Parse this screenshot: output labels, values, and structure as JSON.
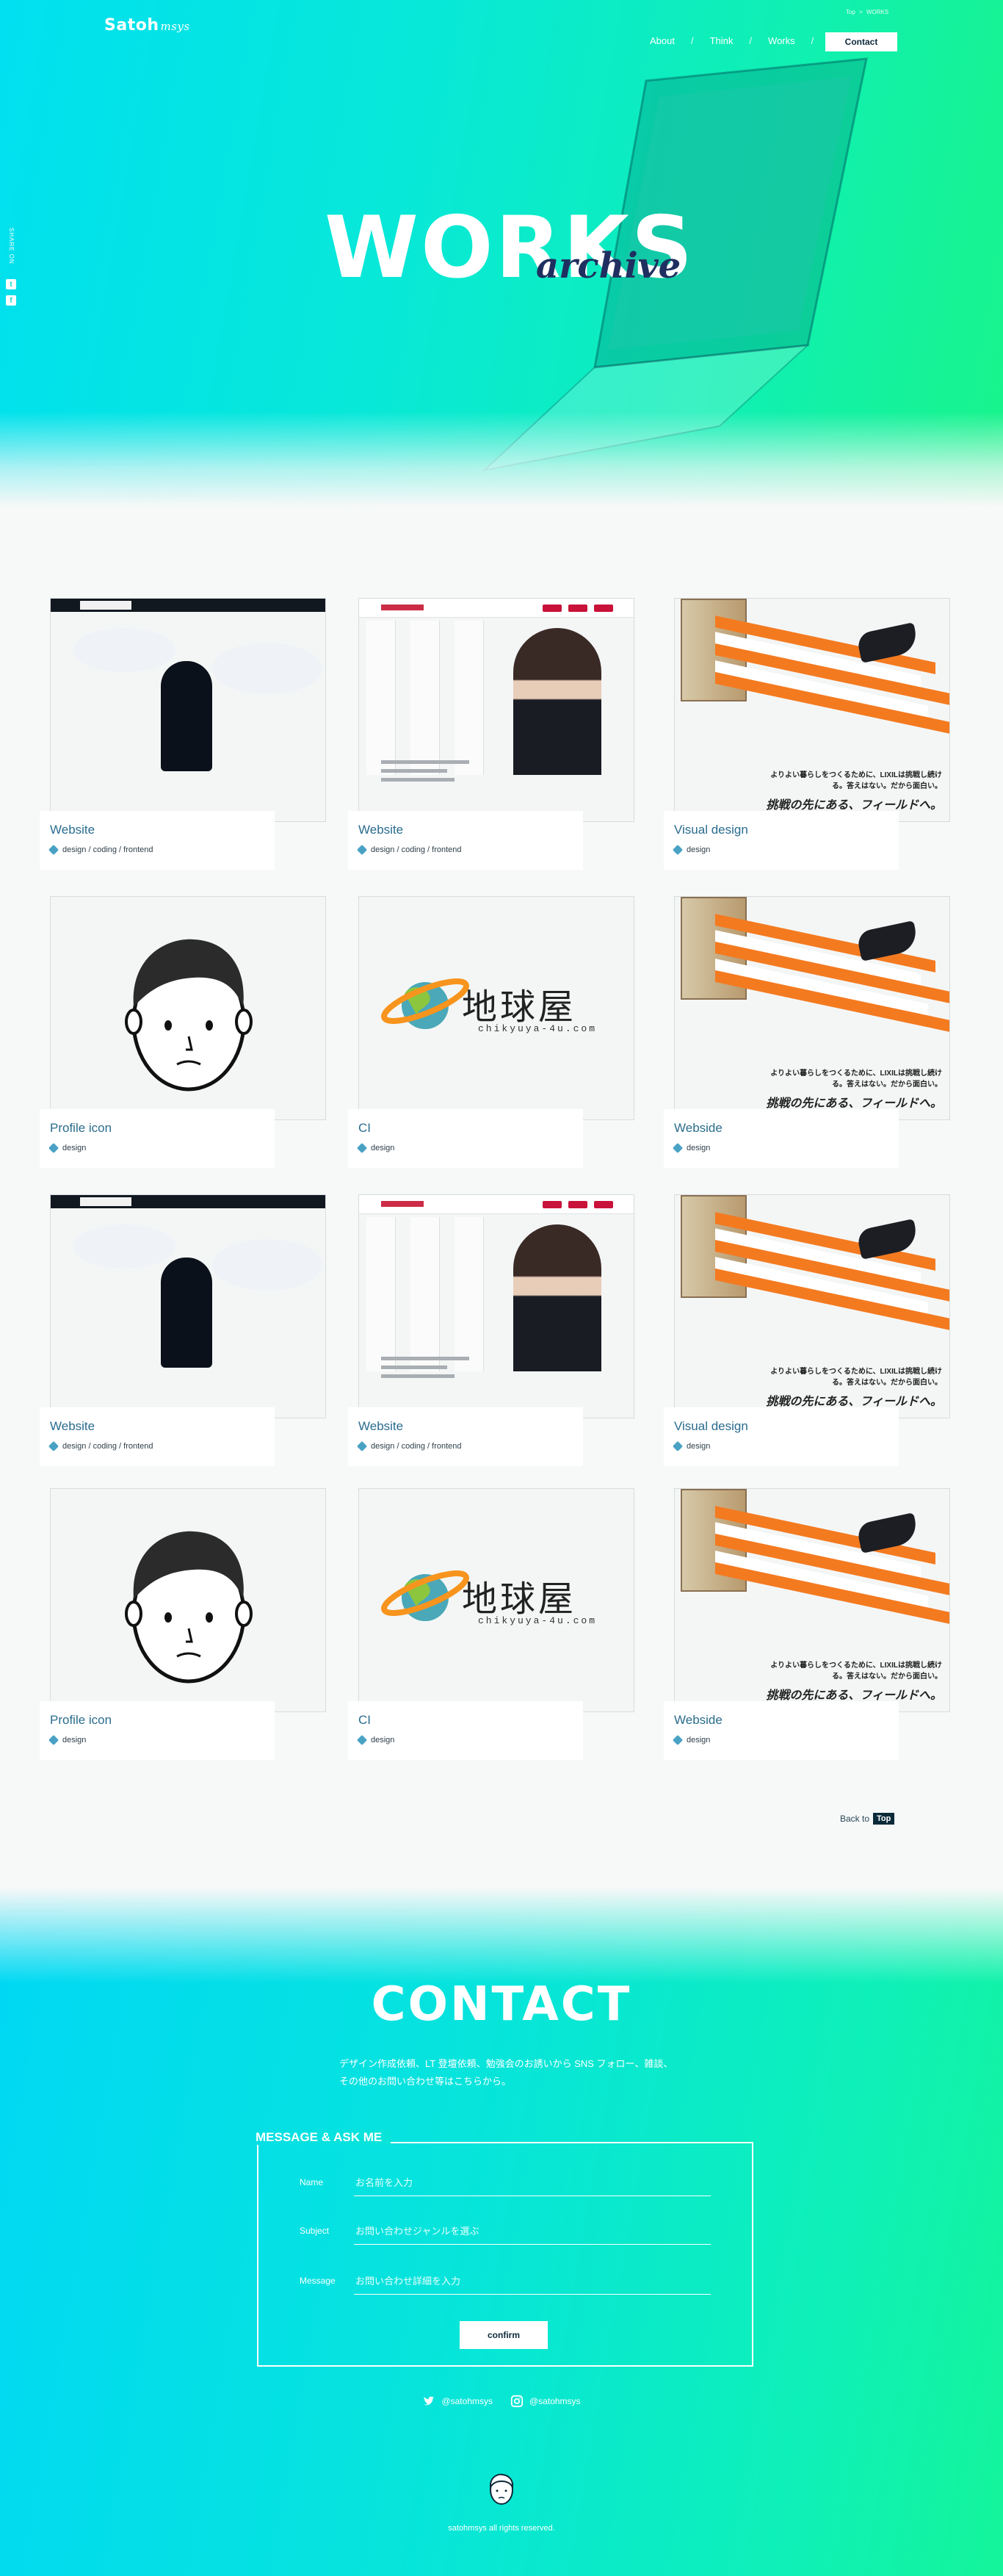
{
  "header": {
    "logo_main": "Satoh",
    "logo_script": "msys",
    "breadcrumb": [
      "Top",
      ">",
      "WORKS"
    ],
    "nav": [
      {
        "label": "About"
      },
      {
        "label": "Think"
      },
      {
        "label": "Works"
      }
    ],
    "nav_separator": "/",
    "contact_button": "Contact",
    "share_label": "SHARE ON",
    "share_twitter_icon": "t",
    "share_facebook_icon": "f"
  },
  "hero": {
    "title": "WORKS",
    "subtitle": "archive"
  },
  "works": [
    {
      "title": "Website",
      "tags": "design / coding / frontend",
      "thumb": "website-panasonic"
    },
    {
      "title": "Website",
      "tags": "design / coding / frontend",
      "thumb": "website-recruit"
    },
    {
      "title": "Visual design",
      "tags": "design",
      "thumb": "visual-lixil"
    },
    {
      "title": "Profile icon",
      "tags": "design",
      "thumb": "profile-face"
    },
    {
      "title": "CI",
      "tags": "design",
      "thumb": "ci-chikyuya"
    },
    {
      "title": "Webside",
      "tags": "design",
      "thumb": "visual-lixil"
    },
    {
      "title": "Website",
      "tags": "design / coding / frontend",
      "thumb": "website-panasonic"
    },
    {
      "title": "Website",
      "tags": "design / coding / frontend",
      "thumb": "website-recruit"
    },
    {
      "title": "Visual design",
      "tags": "design",
      "thumb": "visual-lixil"
    },
    {
      "title": "Profile icon",
      "tags": "design",
      "thumb": "profile-face"
    },
    {
      "title": "CI",
      "tags": "design",
      "thumb": "ci-chikyuya"
    },
    {
      "title": "Webside",
      "tags": "design",
      "thumb": "visual-lixil"
    }
  ],
  "thumb_text": {
    "ci_name": "地球屋",
    "ci_url": "chikyuya-4u.com",
    "lixil_copy": "よりよい暮らしをつくるために、LIXILは挑戦し続ける。答えはない。だから面白い。",
    "lixil_headline": "挑戦の先にある、フィールドへ。"
  },
  "back_to_top": {
    "label": "Back to",
    "button": "Top"
  },
  "contact": {
    "title": "CONTACT",
    "description_line1": "デザイン作成依頼、LT 登壇依頼、勉強会のお誘いから SNS フォロー、雑談、",
    "description_line2": "その他のお問い合わせ等はこちらから。",
    "form_title": "MESSAGE & ASK ME",
    "fields": [
      {
        "label": "Name",
        "placeholder": "お名前を入力"
      },
      {
        "label": "Subject",
        "placeholder": "お問い合わせジャンルを選ぶ"
      },
      {
        "label": "Message",
        "placeholder": "お問い合わせ詳細を入力"
      }
    ],
    "confirm_button": "confirm",
    "social": [
      {
        "label": "@satohmsys",
        "icon": "twitter-icon"
      },
      {
        "label": "@satohmsys",
        "icon": "instagram-icon"
      }
    ],
    "copyright": "satohmsys all rights reserved."
  },
  "colors": {
    "gradient_start": "#00e0f0",
    "gradient_end": "#18f48a",
    "accent_text": "#2a6c8e",
    "dark": "#0c2a3a"
  }
}
